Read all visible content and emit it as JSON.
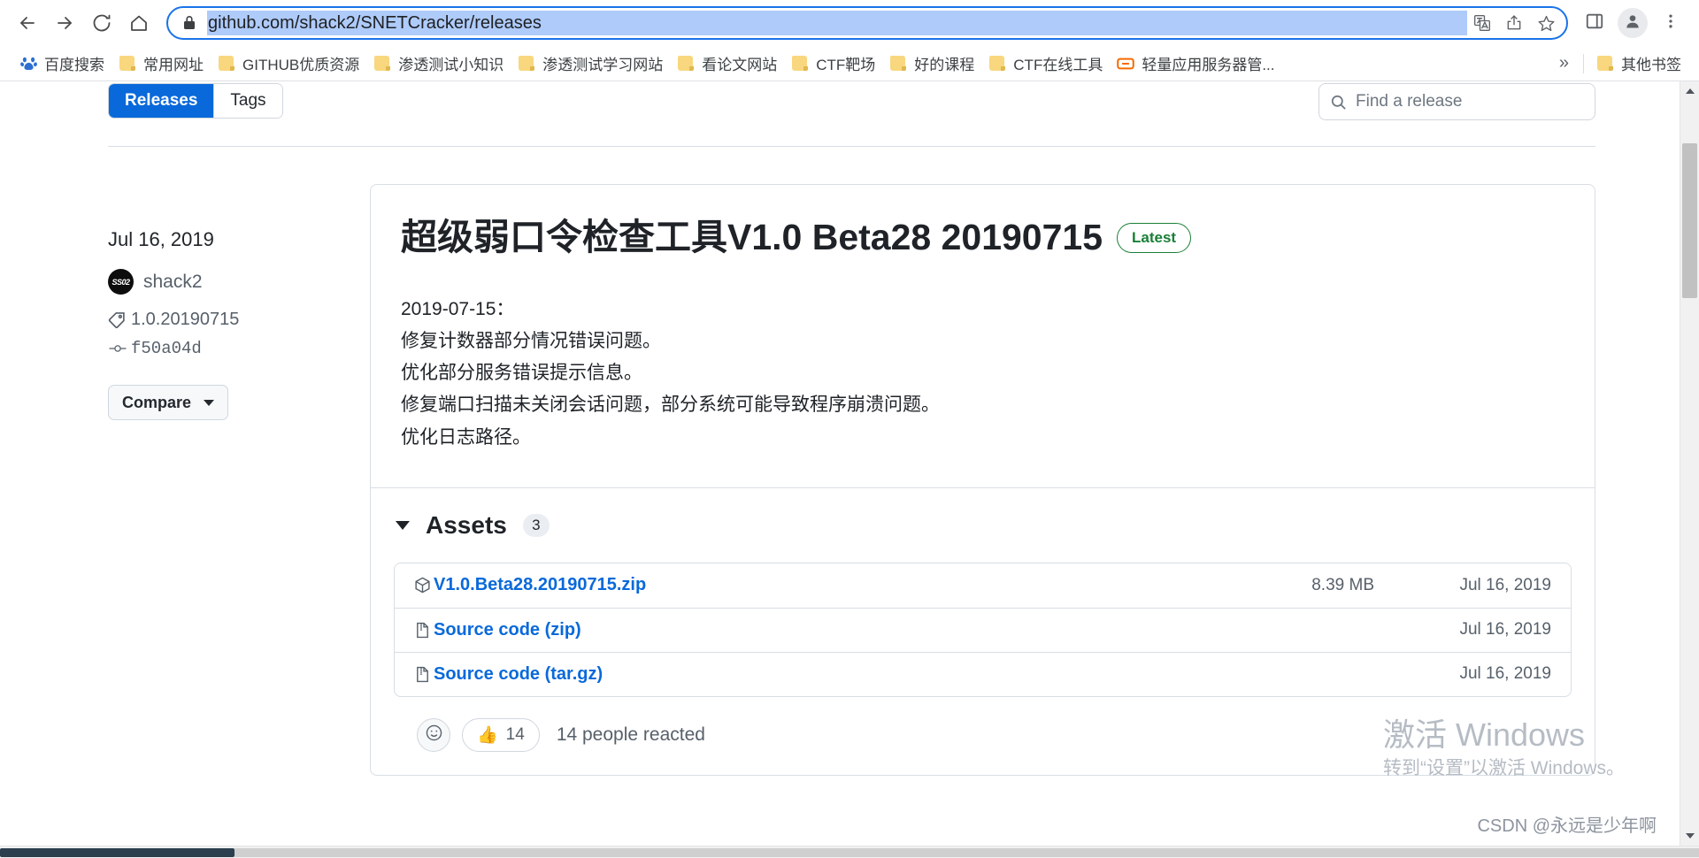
{
  "browser": {
    "nav": {
      "back_label": "Back",
      "forward_label": "Forward",
      "reload_label": "Reload",
      "home_label": "Home"
    },
    "omnibox": {
      "url": "github.com/shack2/SNETCracker/releases",
      "lock_label": "Secure",
      "translate_label": "Translate this page",
      "share_label": "Share this page",
      "bookmark_label": "Bookmark this tab"
    },
    "toolbar": {
      "sidepanel_label": "Side panel",
      "profile_label": "Profile",
      "menu_label": "Customize and control Google Chrome"
    },
    "bookmarks": [
      {
        "label": "百度搜索",
        "icon": "baidu-icon"
      },
      {
        "label": "常用网址",
        "icon": "folder-icon"
      },
      {
        "label": "GITHUB优质资源",
        "icon": "folder-icon"
      },
      {
        "label": "渗透测试小知识",
        "icon": "folder-icon"
      },
      {
        "label": "渗透测试学习网站",
        "icon": "folder-icon"
      },
      {
        "label": "看论文网站",
        "icon": "folder-icon"
      },
      {
        "label": "CTF靶场",
        "icon": "folder-icon"
      },
      {
        "label": "好的课程",
        "icon": "folder-icon"
      },
      {
        "label": "CTF在线工具",
        "icon": "folder-icon"
      },
      {
        "label": "轻量应用服务器管...",
        "icon": "tencent-icon"
      }
    ],
    "bookmarks_overflow_label": "»",
    "other_bookmarks": {
      "label": "其他书签",
      "icon": "folder-icon"
    }
  },
  "page": {
    "tabs": [
      {
        "label": "Releases",
        "active": true
      },
      {
        "label": "Tags",
        "active": false
      }
    ],
    "search": {
      "placeholder": "Find a release",
      "icon": "search-icon"
    },
    "release": {
      "date": "Jul 16, 2019",
      "author": "shack2",
      "avatar_text": "SS02",
      "tag": "1.0.20190715",
      "commit": "f50a04d",
      "compare_label": "Compare",
      "title": "超级弱口令检查工具V1.0 Beta28 20190715",
      "latest_badge": "Latest",
      "body_lines": [
        "2019-07-15：",
        "修复计数器部分情况错误问题。",
        "优化部分服务错误提示信息。",
        "修复端口扫描未关闭会话问题，部分系统可能导致程序崩溃问题。",
        "优化日志路径。"
      ],
      "assets": {
        "label": "Assets",
        "count": "3",
        "rows": [
          {
            "name": "V1.0.Beta28.20190715.zip",
            "size": "8.39 MB",
            "date": "Jul 16, 2019",
            "icon": "package-icon"
          },
          {
            "name": "Source code (zip)",
            "size": "",
            "date": "Jul 16, 2019",
            "icon": "file-zip-icon"
          },
          {
            "name": "Source code (tar.gz)",
            "size": "",
            "date": "Jul 16, 2019",
            "icon": "file-zip-icon"
          }
        ]
      },
      "reactions": {
        "add_icon": "smiley-icon",
        "thumbsup_icon": "👍",
        "thumbsup_count": "14",
        "summary": "14 people reacted"
      }
    }
  },
  "watermark": {
    "line1": "激活 Windows",
    "line2": "转到“设置”以激活 Windows。"
  },
  "footer_credit": "CSDN @永远是少年啊",
  "colors": {
    "accent_blue": "#0969da",
    "omnibox_border": "#1a73e8",
    "url_highlight": "#aecbfa",
    "latest_green": "#1a7f37",
    "folder_yellow": "#f8d77e"
  }
}
